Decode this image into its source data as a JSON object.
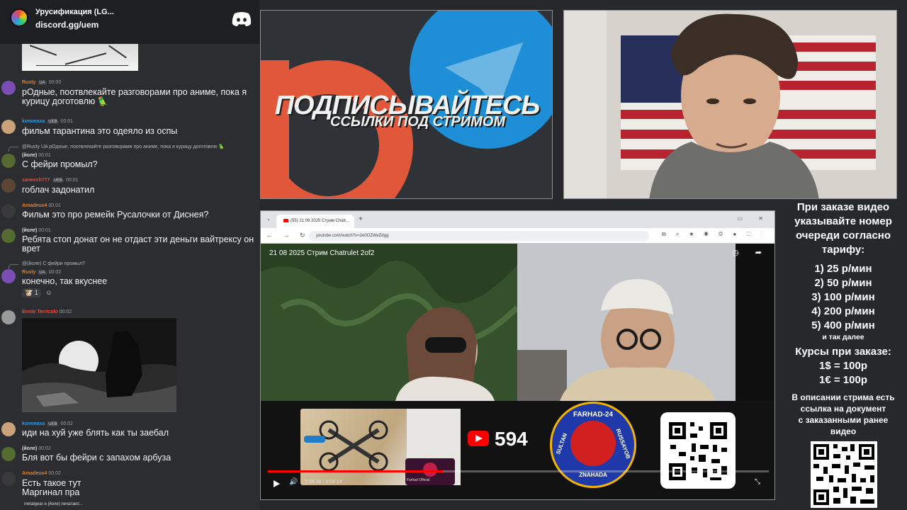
{
  "chat": {
    "server_name": "Урусификация (LG...",
    "server_link": "discord.gg/uem",
    "messages": [
      {
        "user": "Rusty",
        "badges": [
          "UA"
        ],
        "time": "00:00",
        "text": "рОдные, поотвлекайте разговорами про аниме, пока я курицу доготовлю 🦜",
        "user_color": "#e67e22"
      },
      {
        "user": "kommaxa",
        "badges": [
          "UEB"
        ],
        "time": "00:01",
        "text": "фильм тарантина это одеяло из оспы",
        "user_color": "#3498db"
      },
      {
        "reply": "@Rusty UA рОдные, поотвлекайте разговорами про аниме, пока я курицу доготовлю 🦜",
        "user": "(йоле)",
        "badges": [],
        "time": "00:01",
        "text": "С фейри промыл?",
        "user_color": "#dbdee1"
      },
      {
        "user": "saneech777",
        "badges": [
          "UEB"
        ],
        "time": "00:01",
        "text": "гоблач задонатил",
        "user_color": "#e74c3c"
      },
      {
        "user": "Amadeus4",
        "badges": [],
        "time": "00:01",
        "text": "Фильм это про ремейк Русалочки от Диснея?",
        "user_color": "#e67e22"
      },
      {
        "user": "(йоле)",
        "badges": [],
        "time": "00:01",
        "text": "Ребята стоп донат он не отдаст эти деньги вайтрексу он врет",
        "user_color": "#dbdee1"
      },
      {
        "reply": "@(йоле) С фейри промыл?",
        "user": "Rusty",
        "badges": [
          "UA"
        ],
        "time": "00:02",
        "text": "конечно, так вкуснее",
        "user_color": "#e67e22"
      },
      {
        "user": "Ennio Terricolo",
        "badges": [],
        "time": "00:02",
        "text": "",
        "user_color": "#e74c3c"
      },
      {
        "user": "kommaxa",
        "badges": [
          "UEB"
        ],
        "time": "00:02",
        "text": "иди на хуй уже блять как ты заебал",
        "user_color": "#3498db"
      },
      {
        "user": "(йоле)",
        "badges": [],
        "time": "00:02",
        "text": "Бля вот бы фейри с запахом арбуза",
        "user_color": "#dbdee1"
      },
      {
        "user": "Amadeus4",
        "badges": [],
        "time": "00:02",
        "text": "Есть такое тут Маргинал пра",
        "user_color": "#e67e22"
      }
    ],
    "reaction_count": "1",
    "typing": "metalgear и (йоле) печатают..."
  },
  "promo": {
    "title": "ПОДПИСЫВАЙТЕСЬ",
    "subtitle": "ССЫЛКИ ПОД СТРИМОМ"
  },
  "browser": {
    "tab_title": "(55) 21 08 2025 Стрим Chatr...",
    "url": "youtube.com/watch?v=2e0OZWeZdgg",
    "video_title": "21 08 2025 Стрим Chatrulet 2of2",
    "subscriber_count": "594",
    "badge_top": "FARHAD-24",
    "badge_left": "SULTAN",
    "badge_right": "RUSSAYOB",
    "badge_bottom": "ZNAHADA",
    "thumb_label": "Farhad Official",
    "time_display": "1:04:36 / 3:04:14",
    "progress": 0.35
  },
  "info": {
    "order_lines": [
      "При заказе видео",
      "указывайте номер",
      "очереди согласно",
      "тарифу:"
    ],
    "tariffs": [
      "1) 25 р/мин",
      "2) 50 р/мин",
      "3) 100 р/мин",
      "4) 200 р/мин",
      "5) 400 р/мин"
    ],
    "etc": "и так далее",
    "rates_title": "Курсы при заказе:",
    "rates": [
      "1$ = 100р",
      "1€ = 100р"
    ],
    "note_lines": [
      "В описании стрима есть",
      "ссылка на документ",
      "с заказанными ранее",
      "видео"
    ]
  },
  "colors": {
    "discord_bg": "#2b2d31",
    "accent_red": "#ff0000",
    "telegram_blue": "#1e8fd6",
    "patreon_orange": "#e1573a"
  }
}
